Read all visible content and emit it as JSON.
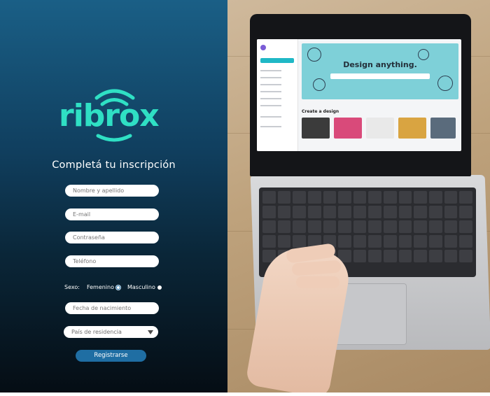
{
  "brand": {
    "logo_text": "ribrox",
    "colors": {
      "teal": "#2fe0c4",
      "panel_top": "#1a5f86",
      "panel_bottom": "#050d14",
      "button": "#1f6ea3"
    }
  },
  "form": {
    "title": "Completá tu inscripción",
    "name_placeholder": "Nombre y apellido",
    "email_placeholder": "E-mail",
    "password_placeholder": "Contraseña",
    "phone_placeholder": "Teléfono",
    "sex_label": "Sexo:",
    "sex_options": [
      "Femenino",
      "Masculino"
    ],
    "sex_selected": "Femenino",
    "birthdate_placeholder": "Fecha de nacimiento",
    "country_selected": "País de residencia",
    "submit_label": "Registrarse"
  },
  "photo": {
    "screen_headline": "Design anything.",
    "screen_section": "Create a design"
  }
}
